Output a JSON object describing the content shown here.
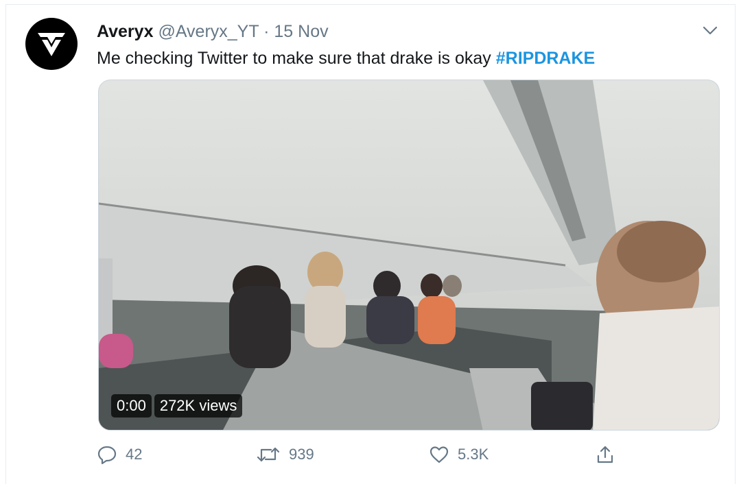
{
  "tweet": {
    "author_name": "Averyx",
    "author_handle": "@Averyx_YT",
    "separator": "·",
    "date": "15 Nov",
    "text": "Me checking Twitter to make sure that drake is okay",
    "hashtag": "#RIPDRAKE",
    "avatar_icon": "averyx-logo-icon",
    "menu_icon": "chevron-down-icon"
  },
  "video": {
    "time": "0:00",
    "views": "272K views"
  },
  "actions": {
    "replies": "42",
    "retweets": "939",
    "likes": "5.3K",
    "reply_icon": "reply-icon",
    "retweet_icon": "retweet-icon",
    "like_icon": "heart-icon",
    "share_icon": "share-icon"
  },
  "colors": {
    "hashtag": "#1b95e0",
    "secondary_text": "#657786",
    "primary_text": "#14171a"
  }
}
